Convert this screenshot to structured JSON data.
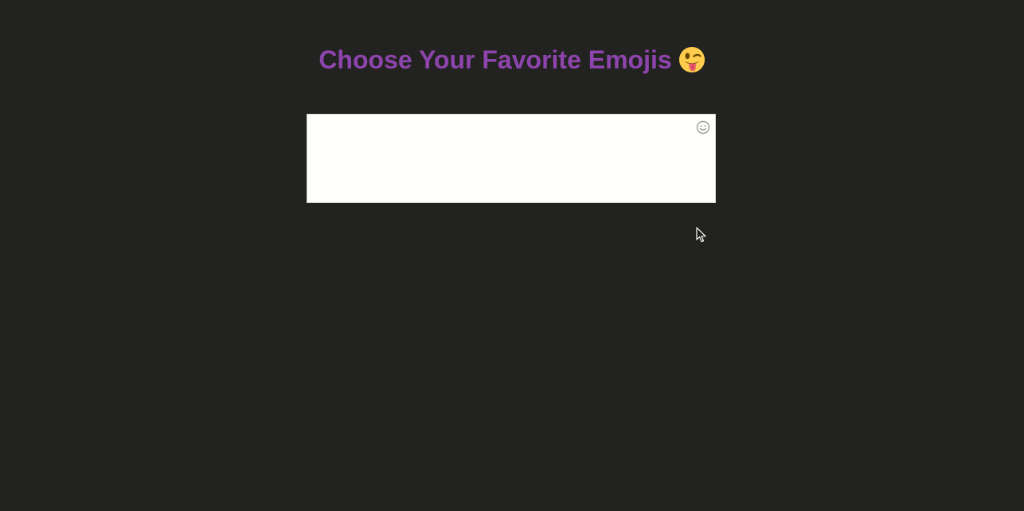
{
  "page": {
    "title": "Choose Your Favorite Emojis",
    "title_emoji": "winking-face-with-tongue"
  },
  "emoji_input": {
    "value": "",
    "placeholder": "",
    "picker_icon": "smiley-icon"
  },
  "colors": {
    "background": "#222220",
    "title": "#8e44ad",
    "input_background": "#fffffc",
    "picker_icon": "#9a9a9a"
  }
}
